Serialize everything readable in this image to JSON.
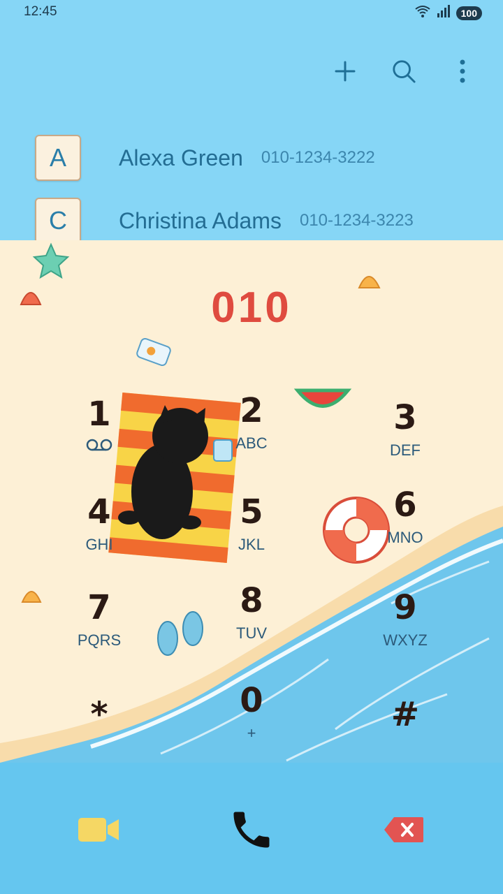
{
  "status": {
    "time": "12:45",
    "battery": "100"
  },
  "actions": {
    "add_icon": "plus-icon",
    "search_icon": "search-icon",
    "more_icon": "more-vertical-icon"
  },
  "contacts": [
    {
      "letter": "A",
      "name": "Alexa Green",
      "number": "010-1234-3222"
    },
    {
      "letter": "C",
      "name": "Christina Adams",
      "number": "010-1234-3223"
    }
  ],
  "dial": {
    "digits": "010"
  },
  "keys": [
    {
      "num": "1",
      "sub": ""
    },
    {
      "num": "2",
      "sub": "ABC"
    },
    {
      "num": "3",
      "sub": "DEF"
    },
    {
      "num": "4",
      "sub": "GHI"
    },
    {
      "num": "5",
      "sub": "JKL"
    },
    {
      "num": "6",
      "sub": "MNO"
    },
    {
      "num": "7",
      "sub": "PQRS"
    },
    {
      "num": "8",
      "sub": "TUV"
    },
    {
      "num": "9",
      "sub": "WXYZ"
    },
    {
      "num": "*",
      "sub": ""
    },
    {
      "num": "0",
      "sub": "+"
    },
    {
      "num": "#",
      "sub": ""
    }
  ],
  "bottom": {
    "video_icon": "video-call-icon",
    "call_icon": "phone-call-icon",
    "delete_icon": "backspace-icon"
  },
  "colors": {
    "top_bg": "#86d6f6",
    "sand": "#fdf0d6",
    "sea": "#65c6ef",
    "digits": "#df4b3f"
  }
}
